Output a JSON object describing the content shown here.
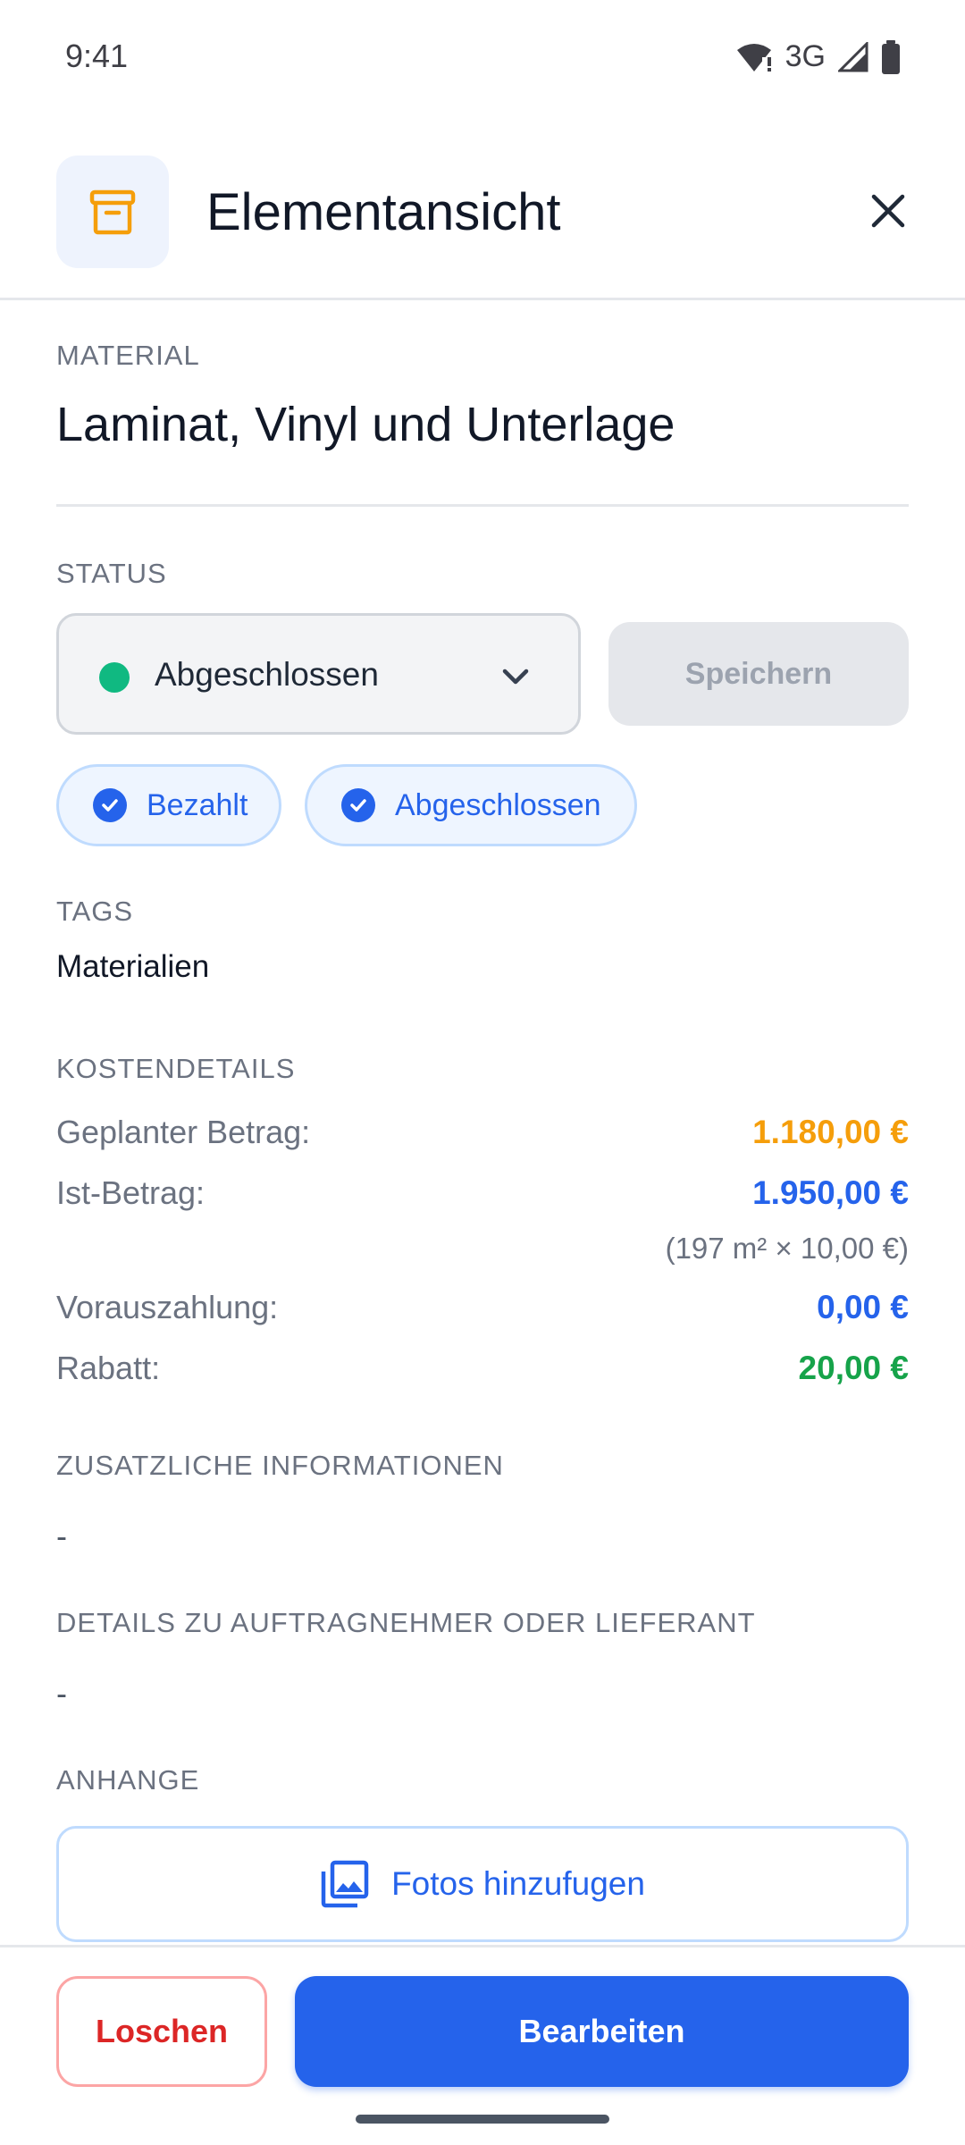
{
  "status_bar": {
    "time": "9:41",
    "network": "3G"
  },
  "header": {
    "title": "Elementansicht"
  },
  "material": {
    "label": "MATERIAL",
    "name": "Laminat, Vinyl und Unterlage"
  },
  "status": {
    "label": "STATUS",
    "selected": "Abgeschlossen",
    "dot_color": "#10b981",
    "save_label": "Speichern",
    "chips": [
      {
        "label": "Bezahlt"
      },
      {
        "label": "Abgeschlossen"
      }
    ]
  },
  "tags": {
    "label": "TAGS",
    "value": "Materialien"
  },
  "costs": {
    "label": "KOSTENDETAILS",
    "planned": {
      "key": "Geplanter Betrag:",
      "value": "1.180,00 €",
      "color": "#f59e0b"
    },
    "actual": {
      "key": "Ist-Betrag:",
      "value": "1.950,00 €",
      "color": "#2563eb",
      "note": "(197 m² × 10,00 €)"
    },
    "prepayment": {
      "key": "Vorauszahlung:",
      "value": "0,00 €",
      "color": "#2563eb"
    },
    "discount": {
      "key": "Rabatt:",
      "value": "20,00 €",
      "color": "#16a34a"
    }
  },
  "additional_info": {
    "label": "ZUSATZLICHE INFORMATIONEN",
    "value": "-"
  },
  "contractor": {
    "label": "DETAILS ZU AUFTRAGNEHMER ODER LIEFERANT",
    "value": "-"
  },
  "attachments": {
    "label": "ANHANGE",
    "add_photos_label": "Fotos hinzufugen"
  },
  "footer": {
    "delete_label": "Loschen",
    "edit_label": "Bearbeiten"
  }
}
